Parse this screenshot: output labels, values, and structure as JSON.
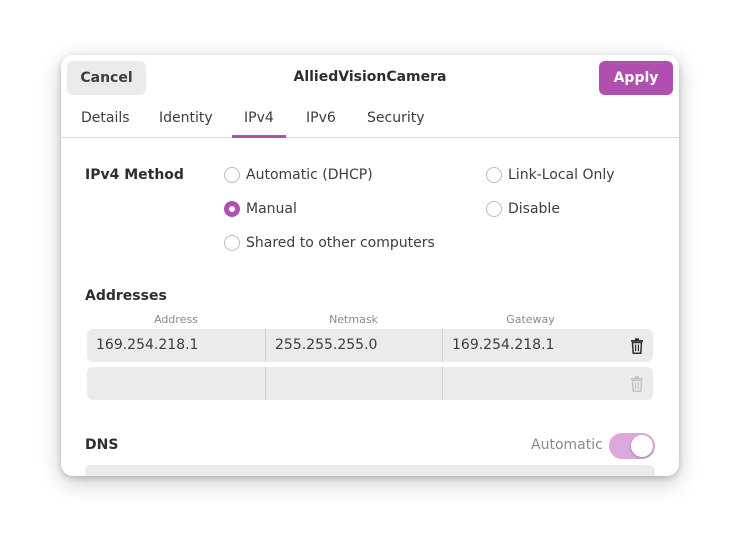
{
  "dialog": {
    "title": "AlliedVisionCamera",
    "cancel_label": "Cancel",
    "apply_label": "Apply"
  },
  "tabs": [
    {
      "label": "Details",
      "active": false
    },
    {
      "label": "Identity",
      "active": false
    },
    {
      "label": "IPv4",
      "active": true
    },
    {
      "label": "IPv6",
      "active": false
    },
    {
      "label": "Security",
      "active": false
    }
  ],
  "ipv4_method": {
    "label": "IPv4 Method",
    "options": [
      {
        "label": "Automatic (DHCP)",
        "checked": false
      },
      {
        "label": "Link-Local Only",
        "checked": false
      },
      {
        "label": "Manual",
        "checked": true
      },
      {
        "label": "Disable",
        "checked": false
      },
      {
        "label": "Shared to other computers",
        "checked": false
      }
    ]
  },
  "addresses": {
    "label": "Addresses",
    "columns": [
      "Address",
      "Netmask",
      "Gateway"
    ],
    "rows": [
      {
        "address": "169.254.218.1",
        "netmask": "255.255.255.0",
        "gateway": "169.254.218.1"
      },
      {
        "address": "",
        "netmask": "",
        "gateway": ""
      }
    ]
  },
  "dns": {
    "label": "DNS",
    "automatic_label": "Automatic",
    "automatic_on": true,
    "value": ""
  },
  "colors": {
    "accent": "#b14fb1",
    "toggle_on_dim": "#dca8dc"
  },
  "icons": [
    "trash-icon"
  ]
}
